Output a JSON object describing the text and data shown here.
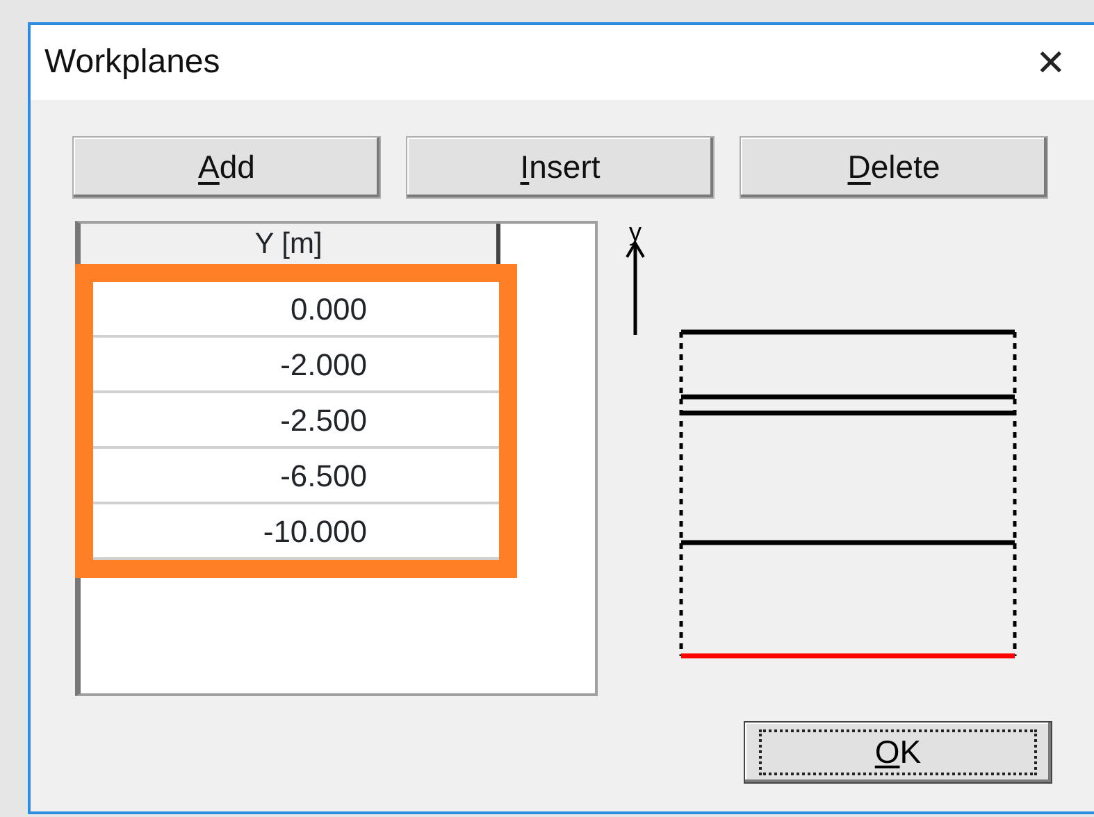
{
  "window": {
    "title": "Workplanes",
    "close": "✕"
  },
  "buttons": [
    {
      "label": "Add",
      "underline_first": true
    },
    {
      "label": "Insert",
      "underline_first": true
    },
    {
      "label": "Delete",
      "underline_first": true
    }
  ],
  "table": {
    "columns": [
      "Y [m]"
    ],
    "highlight": true,
    "rows": [
      {
        "value": "0.000",
        "kind": "plane"
      },
      {
        "value": "-2.000",
        "kind": "plane"
      },
      {
        "value": "-2.500",
        "kind": "plane"
      },
      {
        "value": "-6.500",
        "kind": "plane"
      },
      {
        "value": "-10.000",
        "kind": "bottom"
      }
    ]
  },
  "preview": {
    "axis_label": "y"
  },
  "ok_button": {
    "label": "OK",
    "underline_first": true,
    "focused": true
  }
}
